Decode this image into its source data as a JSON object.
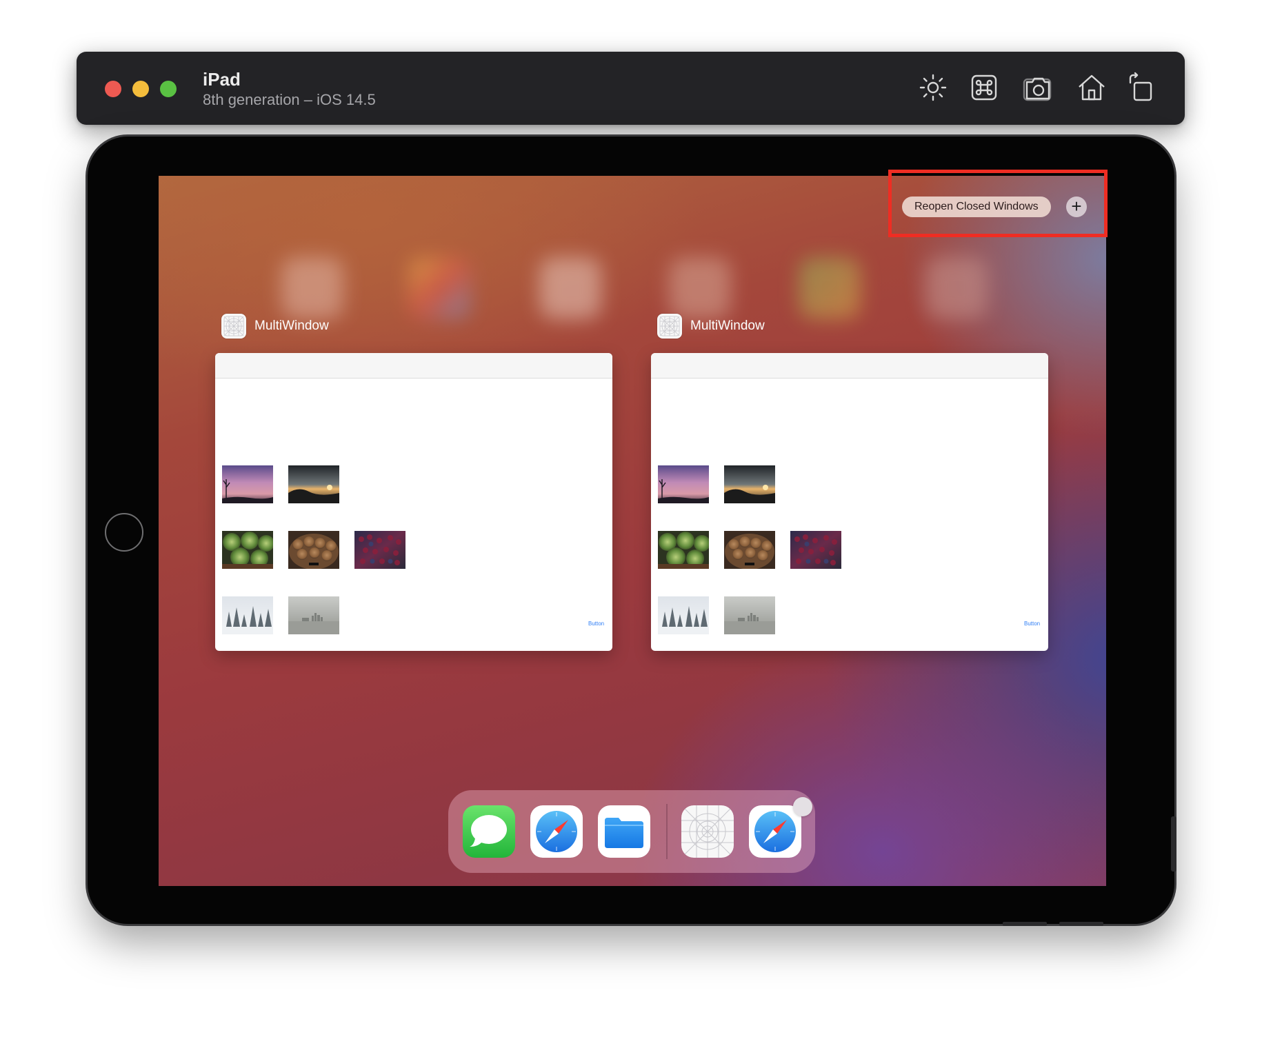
{
  "simulator": {
    "device_name": "iPad",
    "device_subtitle": "8th generation – iOS 14.5",
    "toolbar_icons": [
      "brightness-icon",
      "command-icon",
      "screenshot-icon",
      "home-icon",
      "rotate-icon"
    ]
  },
  "switcher": {
    "reopen_label": "Reopen Closed Windows",
    "plus_label": "+"
  },
  "windows": [
    {
      "app_name": "MultiWindow",
      "button_label": "Button"
    },
    {
      "app_name": "MultiWindow",
      "button_label": "Button"
    }
  ],
  "thumbnails": [
    "sunset-purple",
    "sunset-lake",
    "artichokes",
    "walnuts",
    "berries",
    "snowy-trees",
    "foggy-skyline"
  ],
  "dock": {
    "apps": [
      "messages-icon",
      "safari-icon",
      "files-icon",
      "multiwindow-icon",
      "safari-icon"
    ]
  },
  "colors": {
    "highlight": "#ef2d23",
    "link_blue": "#2f7ef5",
    "traffic_red": "#ee5a52",
    "traffic_yellow": "#f4bd3c",
    "traffic_green": "#5ac143"
  }
}
